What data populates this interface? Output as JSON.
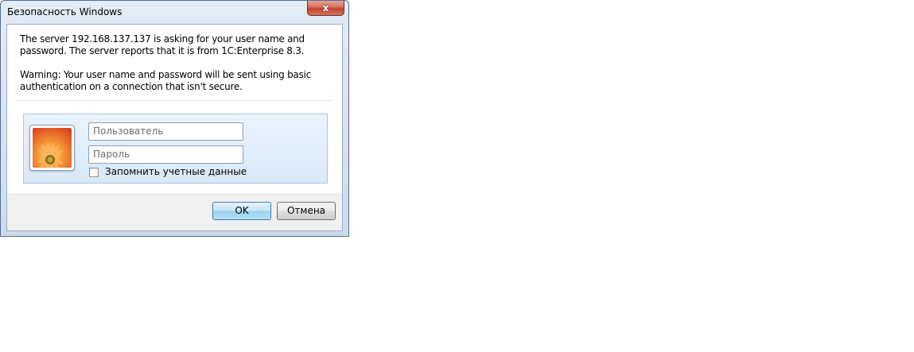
{
  "window": {
    "title": "Безопасность Windows",
    "close_label": "x"
  },
  "message": {
    "line1": "The server 192.168.137.137 is asking for your user name and password. The server reports that it is from 1C:Enterprise 8.3.",
    "line2": "Warning: Your user name and password will be sent using basic authentication on a connection that isn't secure."
  },
  "credentials": {
    "user_icon": "flower-user-tile-icon",
    "username_placeholder": "Пользователь",
    "username_value": "",
    "password_placeholder": "Пароль",
    "password_value": "",
    "remember_label": "Запомнить учетные данные",
    "remember_checked": false
  },
  "buttons": {
    "ok": "OK",
    "cancel": "Отмена"
  },
  "colors": {
    "frame": "#cfdbea",
    "panel": "#dbe9f8",
    "ok_button": "#c4e5f6",
    "close_button": "#c24530"
  }
}
